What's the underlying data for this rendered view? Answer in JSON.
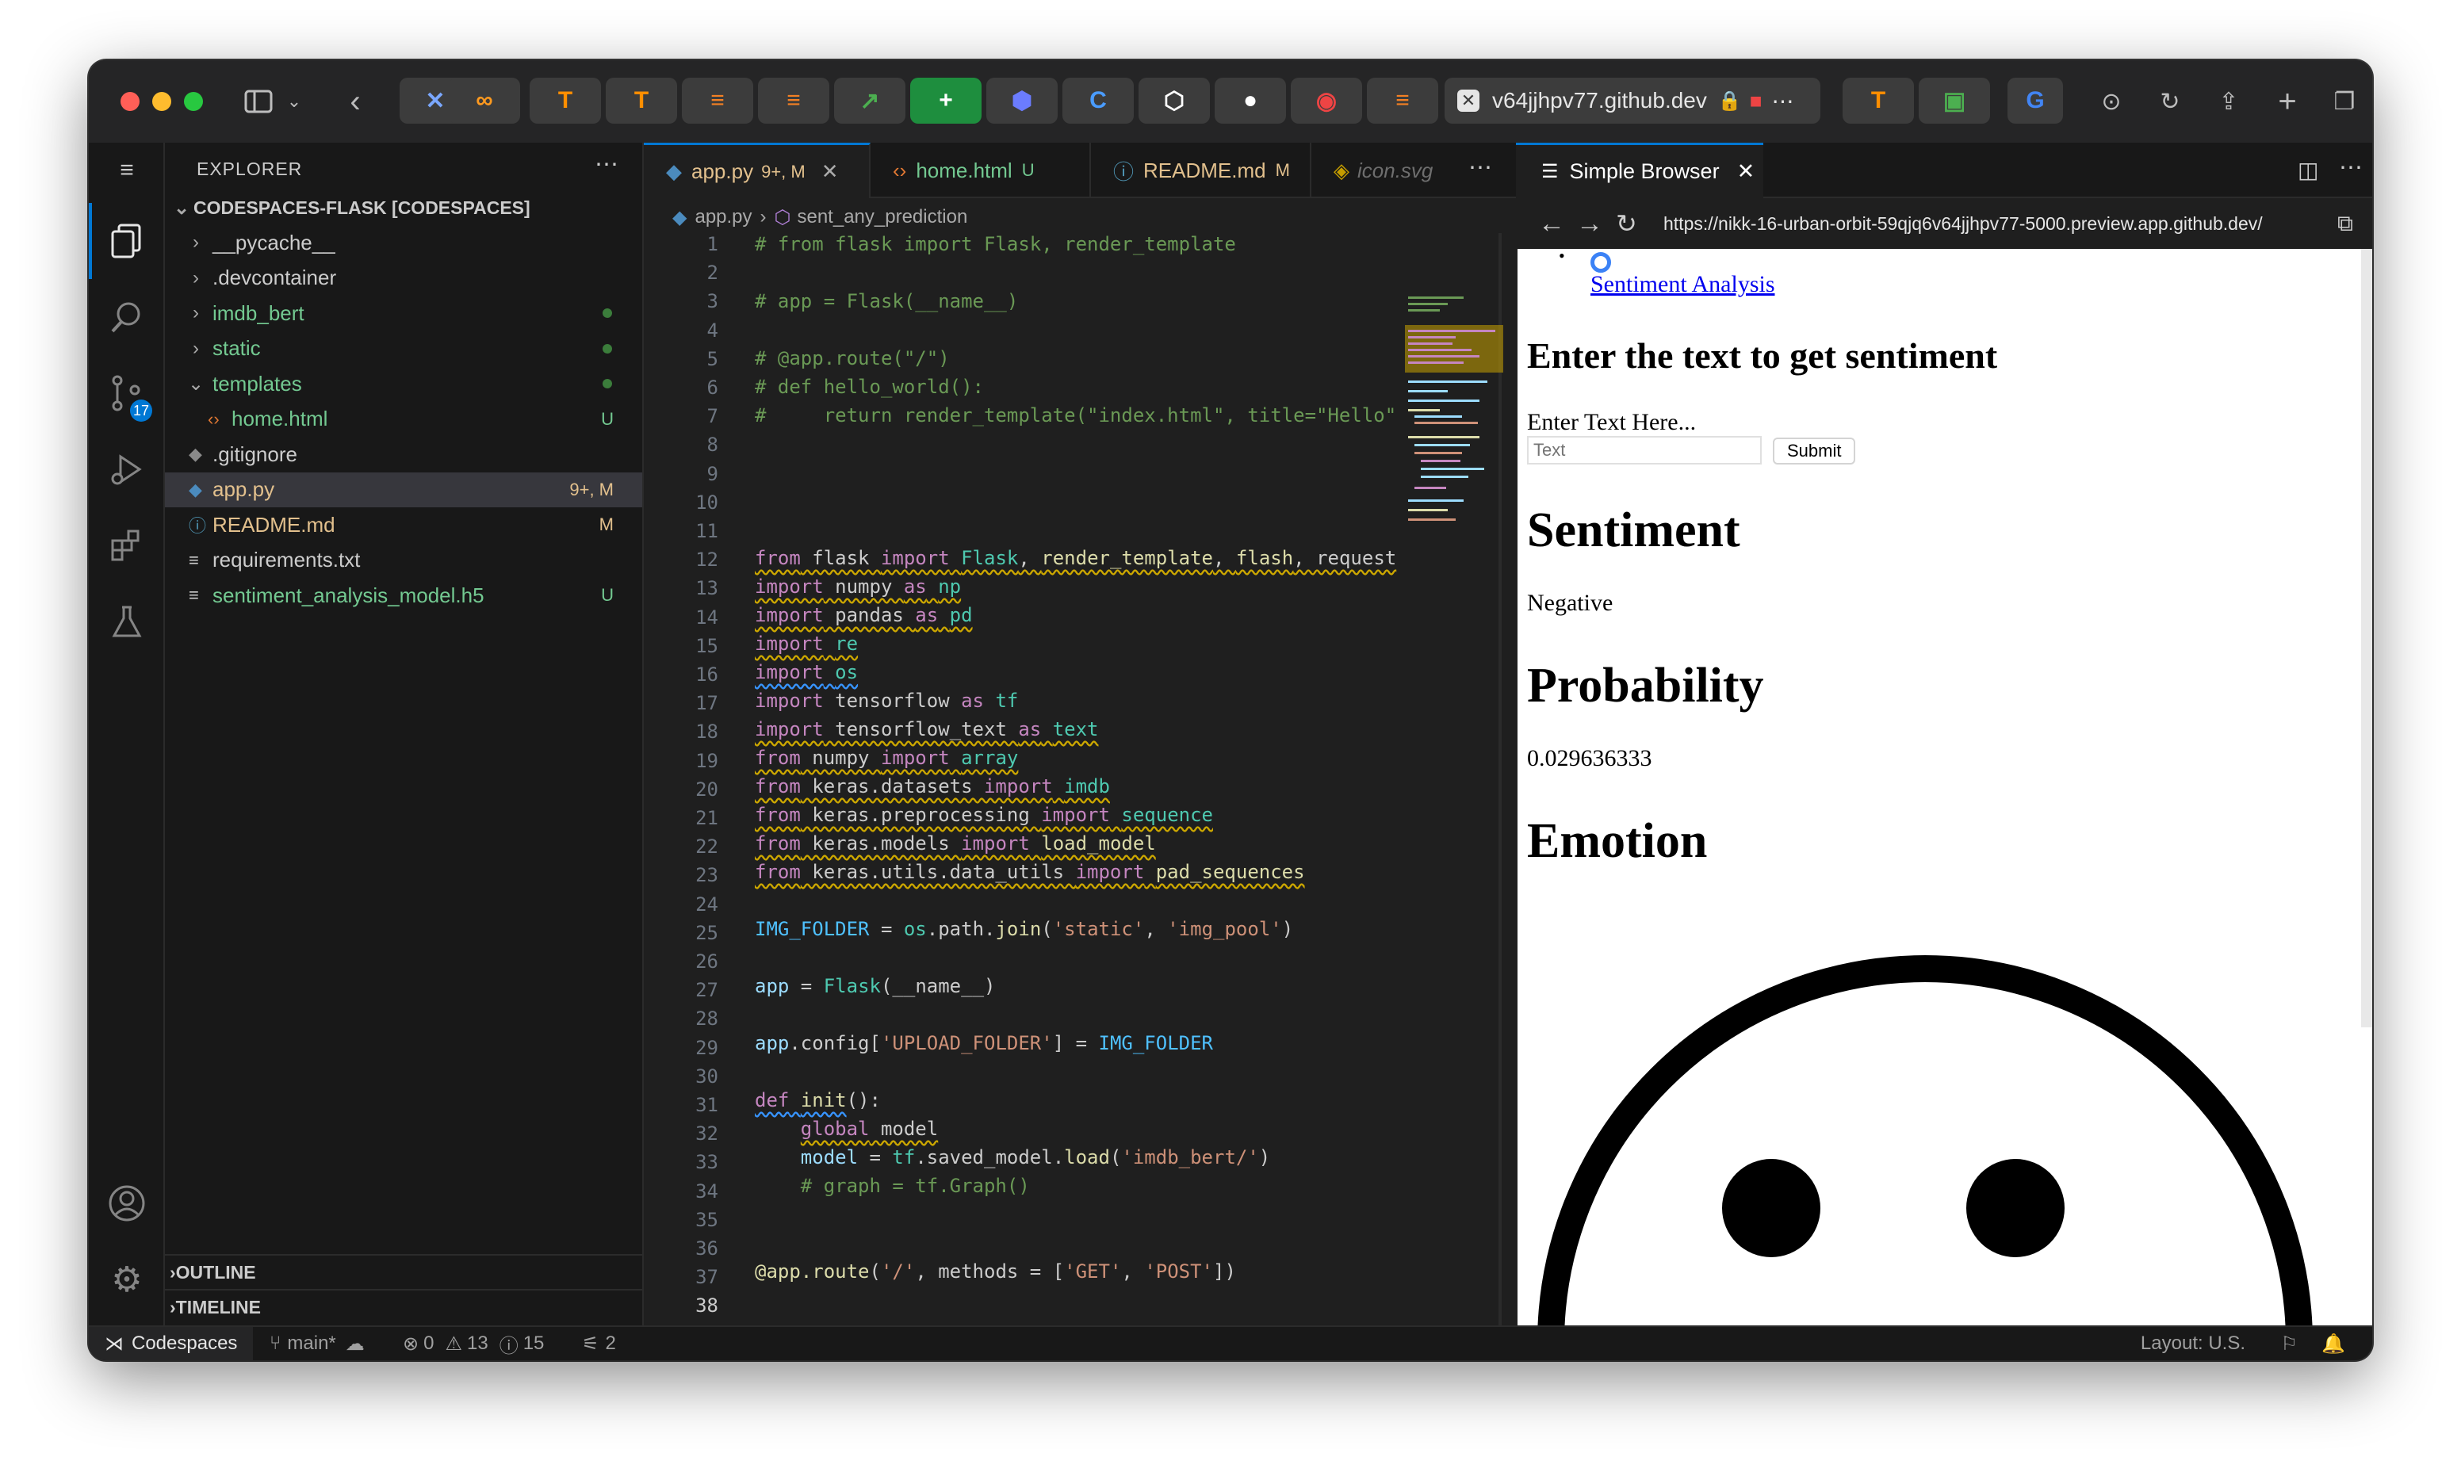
{
  "browser_chrome": {
    "address_text": "v64jjhpv77.github.dev"
  },
  "sidebar": {
    "title": "EXPLORER",
    "workspace": "CODESPACES-FLASK [CODESPACES]",
    "items": [
      {
        "label": "__pycache__",
        "type": "folder",
        "color": "#cccccc",
        "badge": ""
      },
      {
        "label": ".devcontainer",
        "type": "folder",
        "color": "#cccccc",
        "badge": ""
      },
      {
        "label": "imdb_bert",
        "type": "folder",
        "color": "#73c991",
        "badge": ""
      },
      {
        "label": "static",
        "type": "folder",
        "color": "#73c991",
        "badge": ""
      },
      {
        "label": "templates",
        "type": "folder-open",
        "color": "#73c991",
        "badge": ""
      },
      {
        "label": "home.html",
        "type": "html",
        "color": "#73c991",
        "badge": "U"
      },
      {
        "label": ".gitignore",
        "type": "git",
        "color": "#cccccc",
        "badge": ""
      },
      {
        "label": "app.py",
        "type": "python",
        "color": "#e2c08d",
        "badge": "9+, M"
      },
      {
        "label": "README.md",
        "type": "info",
        "color": "#e2c08d",
        "badge": "M"
      },
      {
        "label": "requirements.txt",
        "type": "text",
        "color": "#cccccc",
        "badge": ""
      },
      {
        "label": "sentiment_analysis_model.h5",
        "type": "text",
        "color": "#73c991",
        "badge": "U"
      }
    ],
    "outline_label": "OUTLINE",
    "timeline_label": "TIMELINE"
  },
  "activity": {
    "scm_badge": "17"
  },
  "editor": {
    "tabs": [
      {
        "name": "app.py",
        "status": "9+, M"
      },
      {
        "name": "home.html",
        "status": "U"
      },
      {
        "name": "README.md",
        "status": "M"
      },
      {
        "name": "icon.svg",
        "status": ""
      }
    ],
    "breadcrumb_file": "app.py",
    "breadcrumb_symbol": "sent_any_prediction",
    "line_numbers": [
      "1",
      "2",
      "3",
      "4",
      "5",
      "6",
      "7",
      "8",
      "9",
      "10",
      "11",
      "12",
      "13",
      "14",
      "15",
      "16",
      "17",
      "18",
      "19",
      "20",
      "21",
      "22",
      "23",
      "24",
      "25",
      "26",
      "27",
      "28",
      "29",
      "30",
      "31",
      "32",
      "33",
      "34",
      "35",
      "36",
      "37",
      "38"
    ]
  },
  "simple_browser": {
    "tab_title": "Simple Browser",
    "url": "https://nikk-16-urban-orbit-59qjq6v64jjhpv77-5000.preview.app.github.dev/",
    "page": {
      "nav_link": "Sentiment Analysis",
      "heading_enter": "Enter the text to get sentiment",
      "input_label": "Enter Text Here...",
      "input_placeholder": "Text",
      "submit_label": "Submit",
      "heading_sentiment": "Sentiment",
      "sentiment_value": "Negative",
      "heading_probability": "Probability",
      "probability_value": "0.029636333",
      "heading_emotion": "Emotion"
    }
  },
  "statusbar": {
    "remote": "Codespaces",
    "branch": "main*",
    "errors": "0",
    "warnings": "13",
    "info": "15",
    "ports": "2",
    "layout": "Layout: U.S."
  }
}
